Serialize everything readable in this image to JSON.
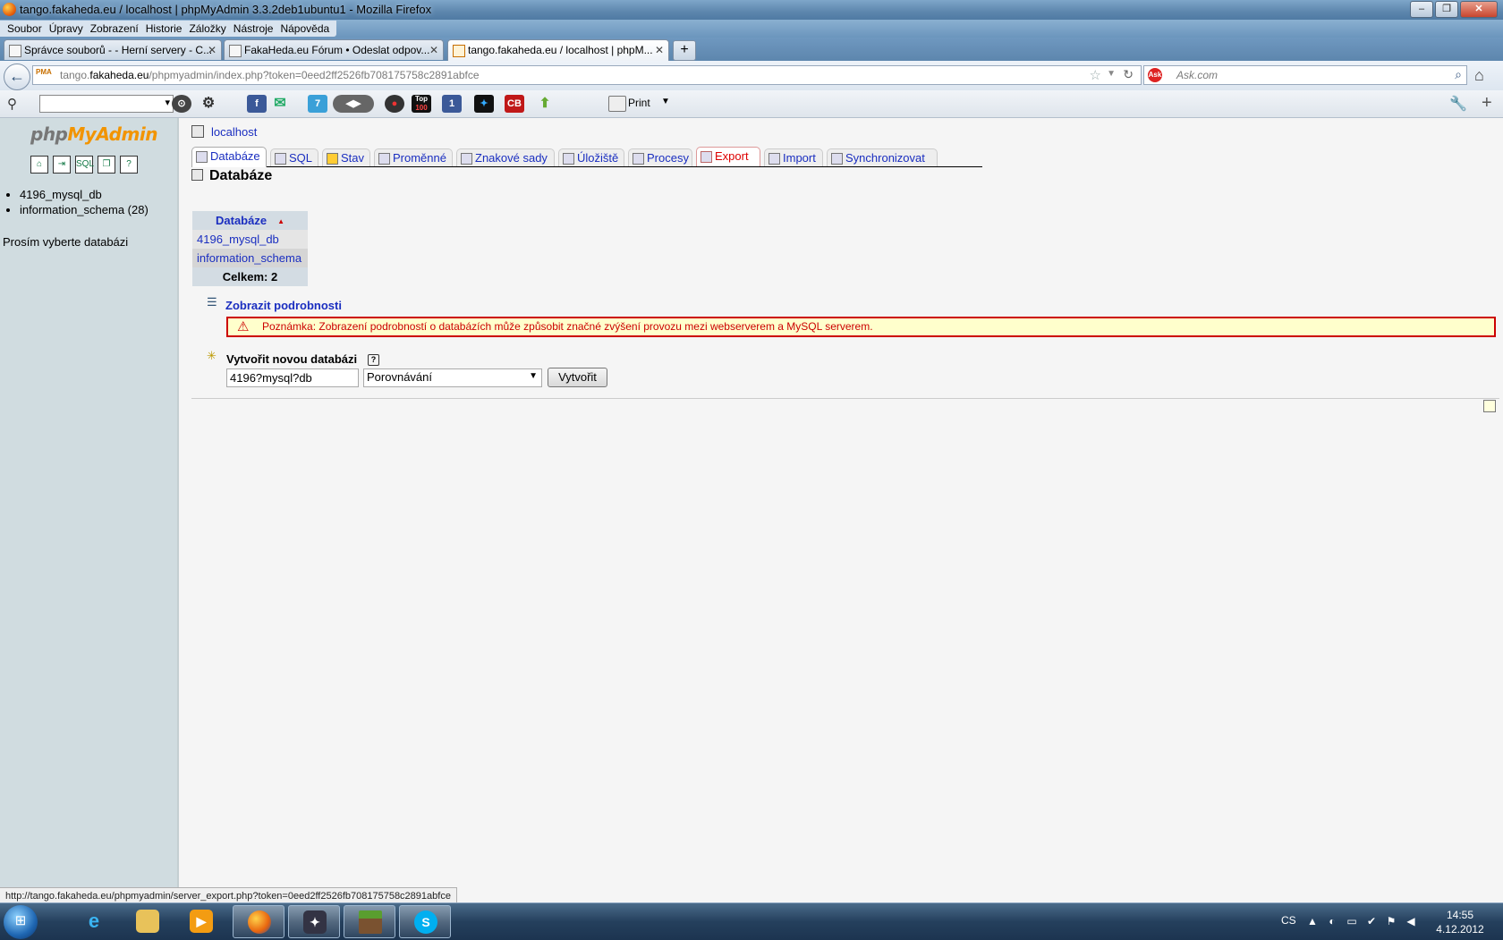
{
  "window": {
    "title": "tango.fakaheda.eu / localhost | phpMyAdmin 3.3.2deb1ubuntu1 - Mozilla Firefox"
  },
  "menubar": [
    "Soubor",
    "Úpravy",
    "Zobrazení",
    "Historie",
    "Záložky",
    "Nástroje",
    "Nápověda"
  ],
  "tabs": [
    {
      "label": "Správce souborů - - Herní servery - C..."
    },
    {
      "label": "FakaHeda.eu Fórum • Odeslat odpov..."
    },
    {
      "label": "tango.fakaheda.eu / localhost | phpM..."
    }
  ],
  "navbar": {
    "url_domain_pre": "tango.",
    "url_domain": "fakaheda.eu",
    "url_path": "/phpmyadmin/index.php?token=0eed2ff2526fb708175758c2891abfce",
    "search_placeholder": "Ask.com"
  },
  "toolbar": {
    "print_label": "Print",
    "badges": {
      "twitter_count": "7",
      "facebook_count": "1",
      "top_label": "Top",
      "top_num": "100",
      "cb_label": "CB"
    }
  },
  "pma": {
    "logo_php": "php",
    "logo_myadmin": "MyAdmin",
    "left_icons": [
      "home",
      "exit",
      "sql",
      "query",
      "docs"
    ],
    "databases": [
      {
        "name": "4196_mysql_db"
      },
      {
        "name": "information_schema (28)"
      }
    ],
    "choose_db": "Prosím vyberte databázi",
    "server": "localhost",
    "tabs": [
      {
        "label": "Databáze"
      },
      {
        "label": "SQL"
      },
      {
        "label": "Stav"
      },
      {
        "label": "Proměnné"
      },
      {
        "label": "Znakové sady"
      },
      {
        "label": "Úložiště"
      },
      {
        "label": "Procesy"
      },
      {
        "label": "Export"
      },
      {
        "label": "Import"
      },
      {
        "label": "Synchronizovat"
      }
    ],
    "page_heading": "Databáze",
    "table": {
      "header": "Databáze",
      "rows": [
        "4196_mysql_db",
        "information_schema"
      ],
      "total": "Celkem: 2"
    },
    "details_link": "Zobrazit podrobnosti",
    "notice": "Poznámka: Zobrazení podrobností o databázích může způsobit značné zvýšení provozu mezi webserverem a MySQL serverem.",
    "create": {
      "label": "Vytvořit novou databázi",
      "help": "?",
      "db_name_value": "4196?mysql?db",
      "collation": "Porovnávání",
      "button": "Vytvořit"
    }
  },
  "statusbar": {
    "text": "http://tango.fakaheda.eu/phpmyadmin/server_export.php?token=0eed2ff2526fb708175758c2891abfce"
  },
  "taskbar": {
    "lang": "CS",
    "time": "14:55",
    "date": "4.12.2012",
    "apps": [
      "internet-explorer",
      "file-explorer",
      "media-player",
      "firefox",
      "counter-strike",
      "minecraft",
      "skype"
    ]
  }
}
